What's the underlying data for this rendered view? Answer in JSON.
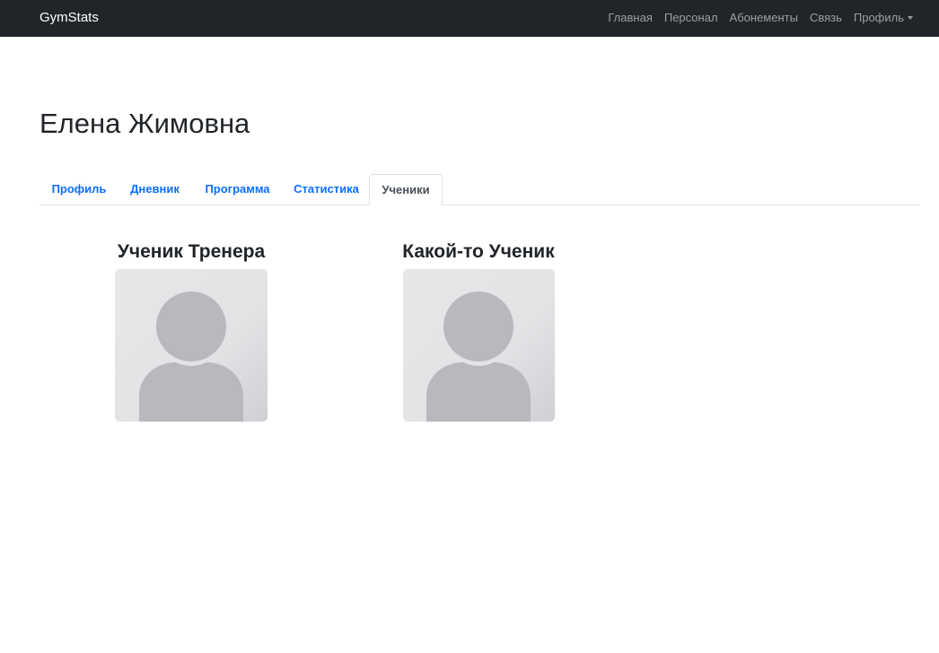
{
  "navbar": {
    "brand": "GymStats",
    "links": [
      {
        "label": "Главная"
      },
      {
        "label": "Персонал"
      },
      {
        "label": "Абонементы"
      },
      {
        "label": "Связь"
      },
      {
        "label": "Профиль"
      }
    ]
  },
  "page": {
    "title": "Елена Жимовна"
  },
  "tabs": [
    {
      "label": "Профиль",
      "active": false
    },
    {
      "label": "Дневник",
      "active": false
    },
    {
      "label": "Программа",
      "active": false
    },
    {
      "label": "Статистика",
      "active": false
    },
    {
      "label": "Ученики",
      "active": true
    }
  ],
  "students": [
    {
      "name": "Ученик Тренера",
      "avatar_icon": "user-placeholder-icon"
    },
    {
      "name": "Какой-то Ученик",
      "avatar_icon": "user-placeholder-icon"
    }
  ],
  "colors": {
    "navbar_bg": "#212529",
    "link_blue": "#0d6efd",
    "active_tab_text": "#495057",
    "avatar_bg": "#e4e5e7",
    "avatar_figure": "#b8b9bc"
  }
}
